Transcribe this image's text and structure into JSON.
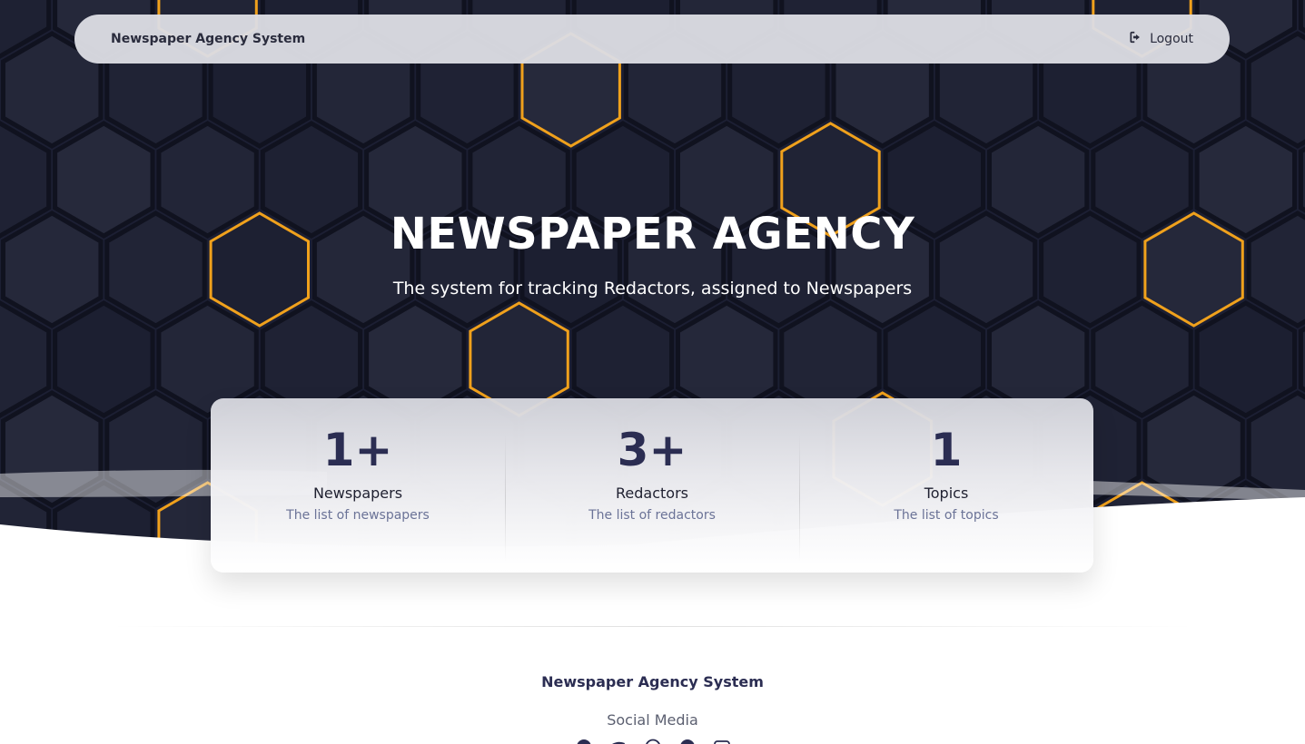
{
  "navbar": {
    "brand": "Newspaper Agency System",
    "logout_label": "Logout",
    "logout_icon": "sign-out-icon"
  },
  "hero": {
    "title": "NEWSPAPER AGENCY",
    "subtitle": "The system for tracking Redactors, assigned to Newspapers"
  },
  "stats": [
    {
      "value": "1+",
      "name": "Newspapers",
      "description": "The list of newspapers"
    },
    {
      "value": "3+",
      "name": "Redactors",
      "description": "The list of redactors"
    },
    {
      "value": "1",
      "name": "Topics",
      "description": "The list of topics"
    }
  ],
  "footer": {
    "brand": "Newspaper Agency System",
    "social_title": "Social Media",
    "social_icons": [
      "facebook-icon",
      "twitter-icon",
      "dribbble-icon",
      "github-icon",
      "youtube-icon"
    ]
  },
  "colors": {
    "hero_background": "#1c1f33",
    "hex_glow": "#f0a11c",
    "accent_text": "#2b2d52",
    "muted_text": "#6b7397"
  }
}
